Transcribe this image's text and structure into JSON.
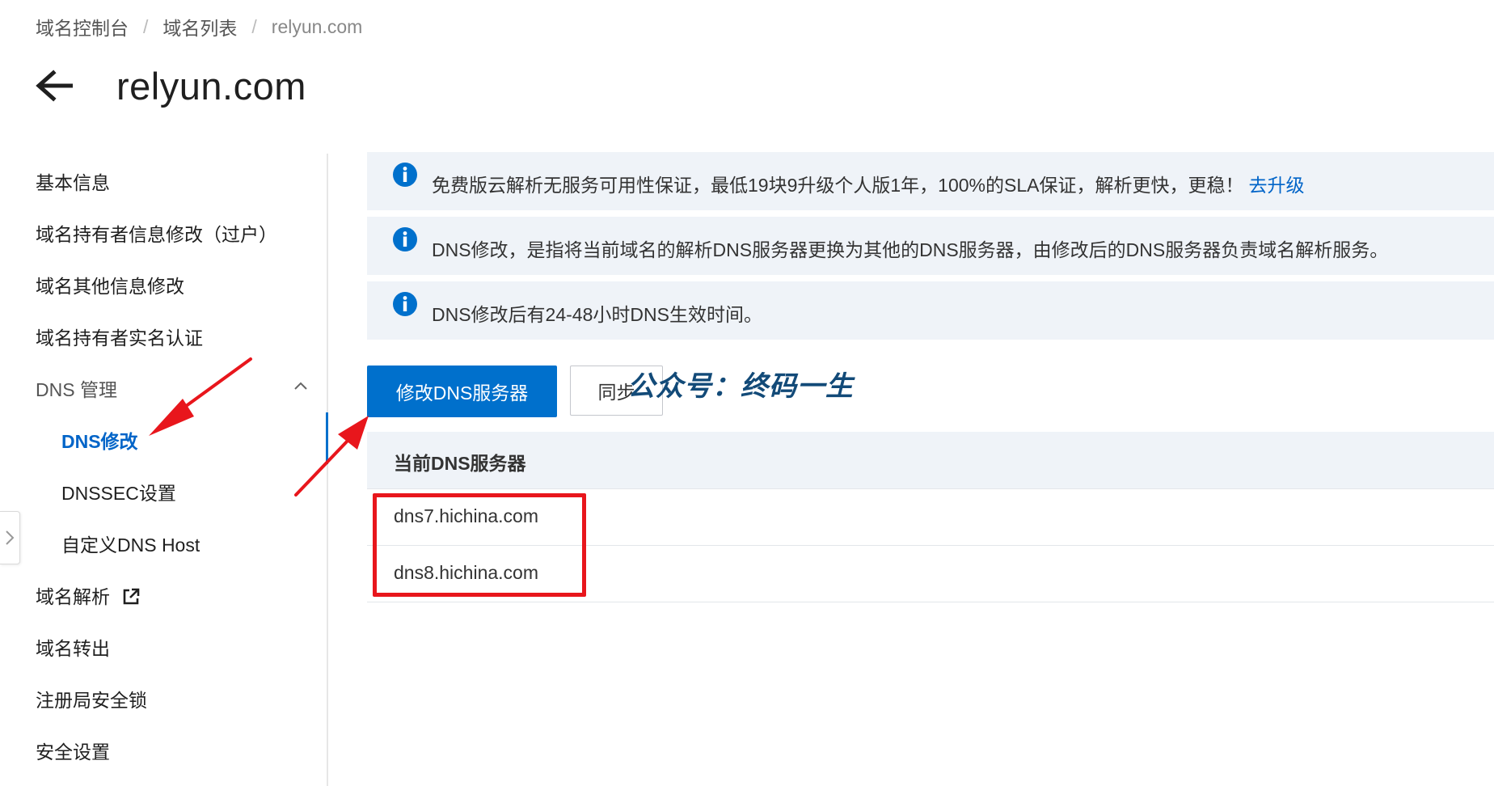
{
  "breadcrumb": {
    "items": [
      "域名控制台",
      "域名列表",
      "relyun.com"
    ],
    "separator": "/"
  },
  "header": {
    "title": "relyun.com"
  },
  "sidebar": {
    "items": [
      {
        "label": "基本信息"
      },
      {
        "label": "域名持有者信息修改（过户）"
      },
      {
        "label": "域名其他信息修改"
      },
      {
        "label": "域名持有者实名认证"
      },
      {
        "label": "DNS 管理",
        "expanded": true
      },
      {
        "label": "DNS修改",
        "active": true
      },
      {
        "label": "DNSSEC设置"
      },
      {
        "label": "自定义DNS Host"
      },
      {
        "label": "域名解析",
        "icon": "external-link-icon"
      },
      {
        "label": "域名转出"
      },
      {
        "label": "注册局安全锁"
      },
      {
        "label": "安全设置"
      }
    ]
  },
  "notices": [
    {
      "text": "免费版云解析无服务可用性保证，最低19块9升级个人版1年，100%的SLA保证，解析更快，更稳！",
      "link": "去升级",
      "icon": "info-icon"
    },
    {
      "text": "DNS修改，是指将当前域名的解析DNS服务器更换为其他的DNS服务器，由修改后的DNS服务器负责域名解析服务。",
      "icon": "info-icon"
    },
    {
      "text": "DNS修改后有24-48小时DNS生效时间。",
      "icon": "info-icon"
    }
  ],
  "actions": {
    "modify_dns": "修改DNS服务器",
    "sync": "同步"
  },
  "watermark": "公众号：终码一生",
  "dns_table": {
    "header": "当前DNS服务器",
    "rows": [
      "dns7.hichina.com",
      "dns8.hichina.com"
    ]
  },
  "colors": {
    "primary": "#0070cc",
    "link": "#0064c8",
    "notice_bg": "#eff3f8",
    "annotation_red": "#e8161c",
    "watermark": "#124a78"
  }
}
